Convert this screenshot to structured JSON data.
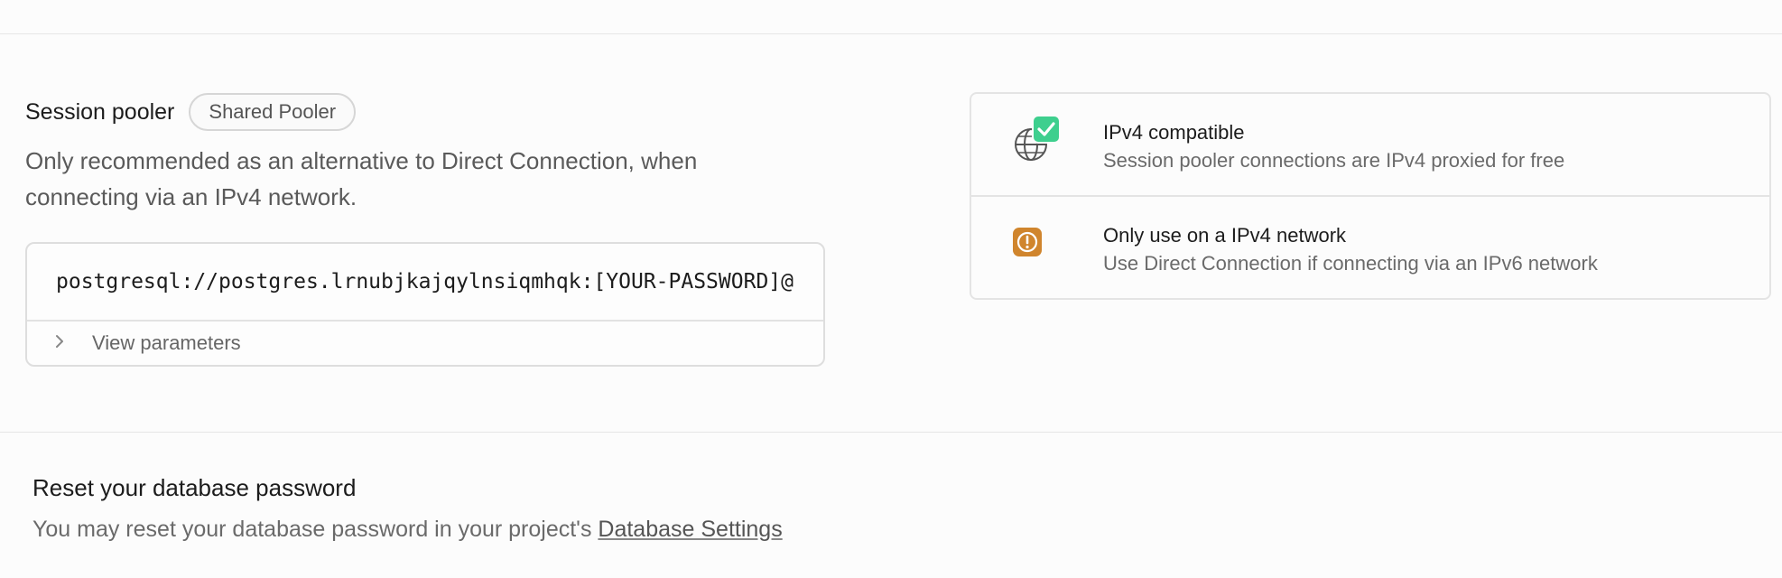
{
  "session_pooler": {
    "title": "Session pooler",
    "badge": "Shared Pooler",
    "description": "Only recommended as an alternative to Direct Connection, when connecting via an IPv4 network.",
    "connection_string": "postgresql://postgres.lrnubjkajqylnsiqmhqk:[YOUR-PASSWORD]@",
    "view_parameters_label": "View parameters",
    "view_parameters_icon": "chevron-right-icon"
  },
  "info_card": {
    "rows": [
      {
        "icon": "globe-check-icon",
        "title": "IPv4 compatible",
        "subtitle": "Session pooler connections are IPv4 proxied for free"
      },
      {
        "icon": "warning-icon",
        "title": "Only use on a IPv4 network",
        "subtitle": "Use Direct Connection if connecting via an IPv6 network"
      }
    ]
  },
  "reset_password": {
    "title": "Reset your database password",
    "description_prefix": "You may reset your database password in your project's ",
    "link_label": "Database Settings"
  },
  "colors": {
    "success_green": "#3ecf8e",
    "warning_orange": "#d0852d",
    "text_primary": "#1c1c1c",
    "text_muted": "#6a6a6a"
  }
}
